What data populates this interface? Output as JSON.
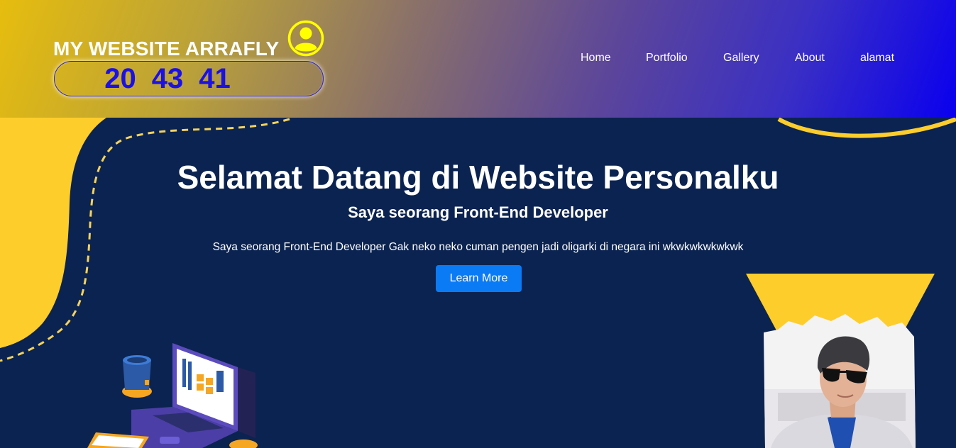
{
  "header": {
    "brand_title": "MY WEBSITE ARRAFLY",
    "clock": {
      "hours": "20",
      "minutes": "43",
      "seconds": "41"
    },
    "nav": [
      {
        "label": "Home"
      },
      {
        "label": "Portfolio"
      },
      {
        "label": "Gallery"
      },
      {
        "label": "About"
      },
      {
        "label": "alamat"
      }
    ]
  },
  "hero": {
    "title": "Selamat Datang di Website Personalku",
    "subtitle": "Saya seorang Front-End Developer",
    "description": "Saya seorang Front-End Developer Gak neko neko cuman pengen jadi oligarki di negara ini wkwkwkwkwkwk",
    "cta_label": "Learn More"
  },
  "colors": {
    "hero_background": "#0b2350",
    "accent_yellow": "#fdcd2c",
    "button_blue": "#0b7bf5",
    "clock_text": "#1a10e8",
    "user_icon": "#ffff00"
  },
  "icons": {
    "user": "user-circle-icon"
  }
}
